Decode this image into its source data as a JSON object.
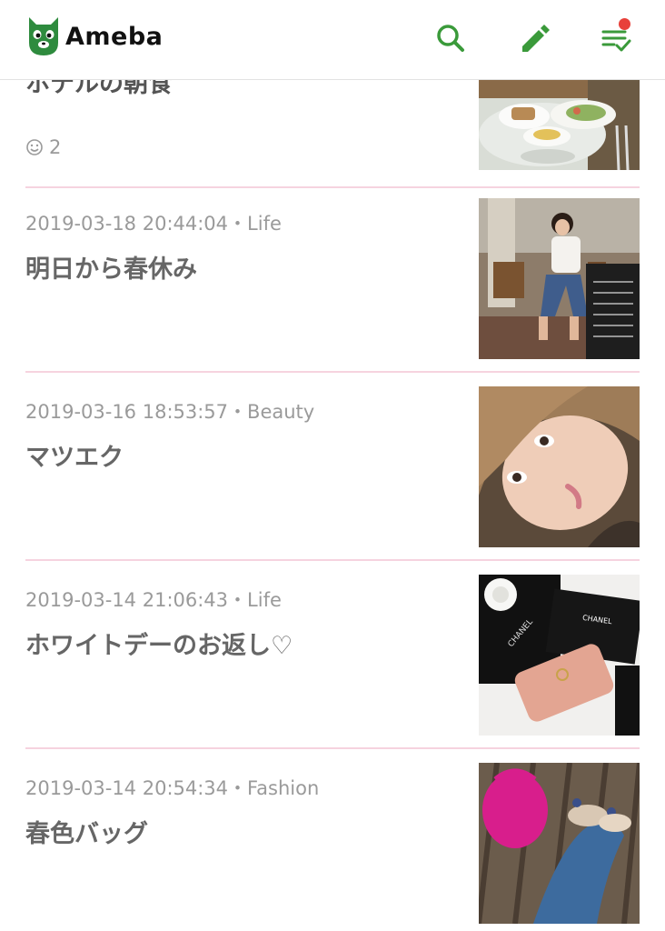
{
  "brand": {
    "name": "Ameba",
    "accent": "#3a9a3a",
    "notification_color": "#e8403a"
  },
  "header": {
    "icons": [
      "search-icon",
      "pencil-icon",
      "checklist-icon"
    ]
  },
  "entries": [
    {
      "title": "ホテルの朝食",
      "likes": "2"
    },
    {
      "date": "2019-03-18 20:44:04",
      "category": "Life",
      "meta": "2019-03-18 20:44:04・Life",
      "title": "明日から春休み"
    },
    {
      "date": "2019-03-16 18:53:57",
      "category": "Beauty",
      "meta": "2019-03-16 18:53:57・Beauty",
      "title": "マツエク"
    },
    {
      "date": "2019-03-14 21:06:43",
      "category": "Life",
      "meta": "2019-03-14 21:06:43・Life",
      "title": "ホワイトデーのお返し♡"
    },
    {
      "date": "2019-03-14 20:54:34",
      "category": "Fashion",
      "meta": "2019-03-14 20:54:34・Fashion",
      "title": "春色バッグ"
    }
  ],
  "thumb_text": {
    "brand_mark": "CHANEL"
  }
}
